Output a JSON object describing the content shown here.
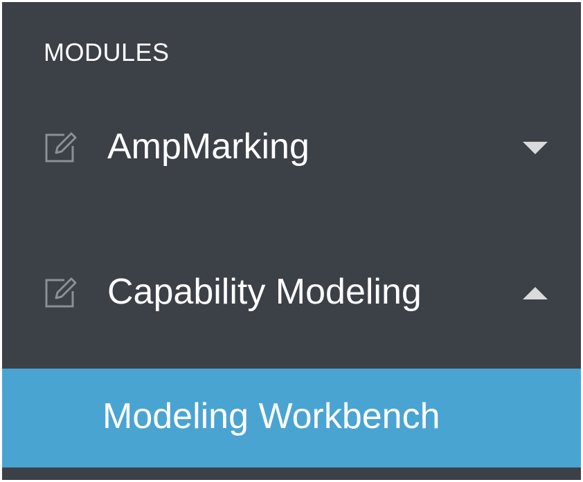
{
  "sidebar": {
    "section_title": "MODULES",
    "colors": {
      "background": "#3c4047",
      "active_background": "#4aa4d2",
      "text": "#ffffff",
      "icon": "#8a9099",
      "caret": "#d8dadc"
    },
    "modules": [
      {
        "label": "AmpMarking",
        "icon": "edit-icon",
        "state": "collapsed",
        "caret_icon": "caret-down-icon"
      },
      {
        "label": "Capability Modeling",
        "icon": "edit-icon",
        "state": "expanded",
        "caret_icon": "caret-up-icon",
        "children": [
          {
            "label": "Modeling Workbench",
            "active": true
          }
        ]
      }
    ]
  }
}
